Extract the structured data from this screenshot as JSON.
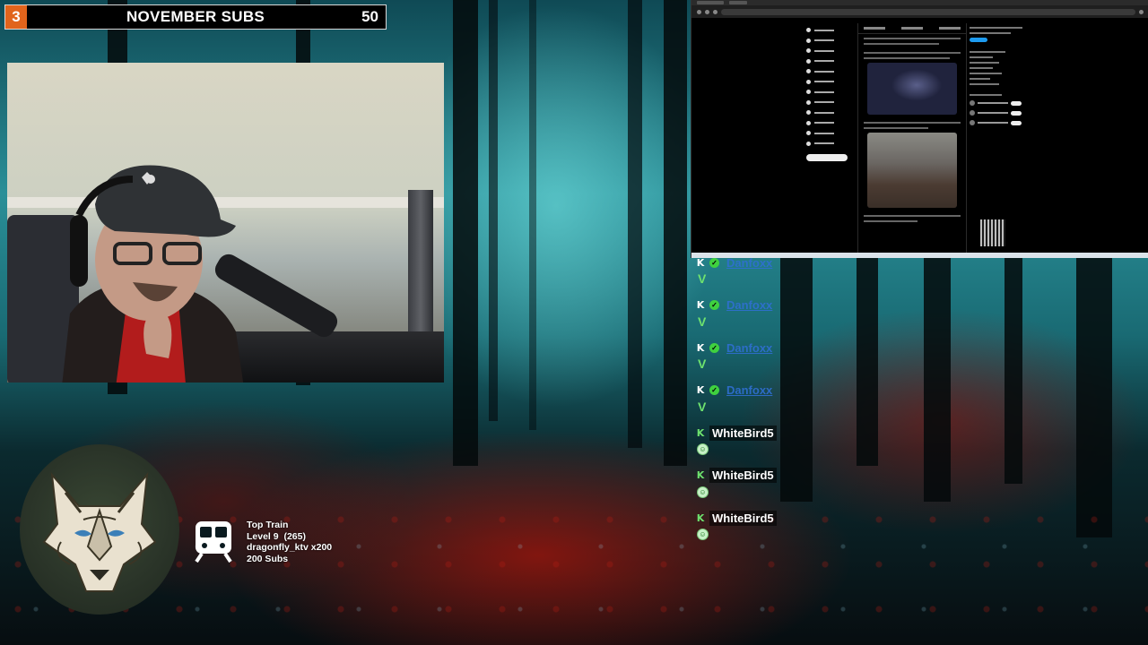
{
  "subs_bar": {
    "count": "3",
    "label": "NOVEMBER SUBS",
    "goal": "50"
  },
  "chat": {
    "messages": [
      {
        "user": "Danfoxx",
        "text": "V",
        "style": "dan"
      },
      {
        "user": "Danfoxx",
        "text": "V",
        "style": "dan"
      },
      {
        "user": "Danfoxx",
        "text": "V",
        "style": "dan"
      },
      {
        "user": "Danfoxx",
        "text": "V",
        "style": "dan"
      },
      {
        "user": "WhiteBird5",
        "text": "",
        "style": "bird"
      },
      {
        "user": "WhiteBird5",
        "text": "",
        "style": "bird"
      },
      {
        "user": "WhiteBird5",
        "text": "",
        "style": "bird"
      }
    ],
    "badge_icon": "kick-badge-icon",
    "verified_icon": "check-badge-icon",
    "emote_icon": "smile-emote-icon"
  },
  "top_train": {
    "title": "Top Train",
    "level": "Level 9  (265)",
    "user": "dragonfly_ktv x200",
    "subs": "200 Subs",
    "icon": "train-icon"
  },
  "colors": {
    "subs_count_bg": "#e1641c",
    "chat_green": "#6ee26e",
    "chat_blue": "#2f6fd2"
  }
}
